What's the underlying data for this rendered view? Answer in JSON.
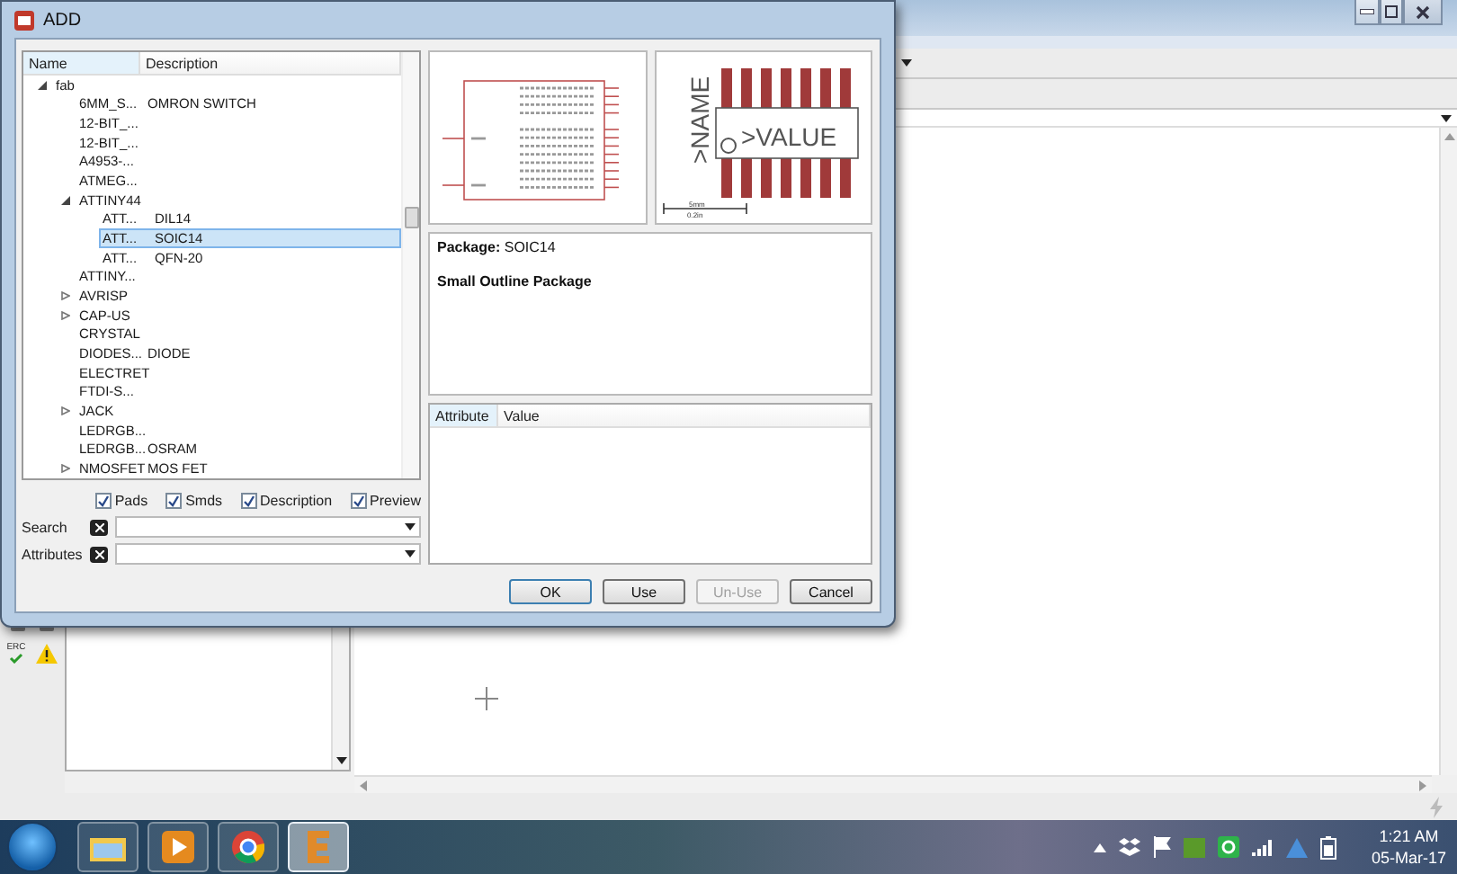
{
  "dialog": {
    "title": "ADD",
    "tree": {
      "columns": [
        "Name",
        "Description"
      ],
      "items": [
        {
          "name": "fab",
          "expanded": true,
          "selected": false,
          "children": [
            {
              "name": "6MM_S...",
              "description": "OMRON SWITCH",
              "selected": false
            },
            {
              "name": "12-BIT_...",
              "selected": false
            },
            {
              "name": "12-BIT_...",
              "selected": false
            },
            {
              "name": "A4953-...",
              "selected": false
            },
            {
              "name": "ATMEG...",
              "selected": false
            },
            {
              "name": "ATTINY44",
              "expanded": true,
              "selected": false,
              "children": [
                {
                  "name": "ATT...",
                  "description": "DIL14",
                  "selected": false
                },
                {
                  "name": "ATT...",
                  "description": "SOIC14",
                  "selected": true
                },
                {
                  "name": "ATT...",
                  "description": "QFN-20",
                  "selected": false
                }
              ]
            },
            {
              "name": "ATTINY...",
              "selected": false
            },
            {
              "name": "AVRISP",
              "expanded": false,
              "selected": false
            },
            {
              "name": "CAP-US",
              "expanded": false,
              "selected": false
            },
            {
              "name": "CRYSTAL",
              "selected": false
            },
            {
              "name": "DIODES...",
              "description": "DIODE",
              "selected": false
            },
            {
              "name": "ELECTRET",
              "selected": false
            },
            {
              "name": "FTDI-S...",
              "selected": false
            },
            {
              "name": "JACK",
              "expanded": false,
              "selected": false
            },
            {
              "name": "LEDRGB...",
              "selected": false
            },
            {
              "name": "LEDRGB...",
              "description": "OSRAM",
              "selected": false
            },
            {
              "name": "NMOSFET",
              "description": "MOS FET",
              "expanded": false,
              "selected": false
            }
          ]
        }
      ]
    },
    "filters": [
      {
        "label": "Pads",
        "checked": true
      },
      {
        "label": "Smds",
        "checked": true
      },
      {
        "label": "Description",
        "checked": true
      },
      {
        "label": "Preview",
        "checked": true
      }
    ],
    "fields": [
      {
        "label": "Search"
      },
      {
        "label": "Attributes"
      }
    ],
    "package_preview": {
      "name_label": ">NAME",
      "value_label": ">VALUE",
      "scale_metric": "5mm",
      "scale_imperial": "0.2in"
    },
    "description": {
      "package": "**Package:** SOIC14",
      "title": "Small Outline Package"
    },
    "attributes": {
      "columns": [
        "Attribute",
        "Value"
      ]
    },
    "buttons": [
      {
        "label": "OK",
        "default": true,
        "disabled": false
      },
      {
        "label": "Use",
        "default": false,
        "disabled": false
      },
      {
        "label": "Un-Use",
        "default": false,
        "disabled": true
      },
      {
        "label": "Cancel",
        "default": false,
        "disabled": false
      }
    ]
  },
  "sidebar": {
    "erc_label": "ERC"
  },
  "taskbar": {
    "apps": [
      {
        "kind": "folder",
        "selected": false
      },
      {
        "kind": "media",
        "selected": false
      },
      {
        "kind": "browser",
        "selected": false
      },
      {
        "kind": "eagle",
        "selected": true
      }
    ],
    "time": "1:21 AM",
    "date": "05-Mar-17"
  }
}
